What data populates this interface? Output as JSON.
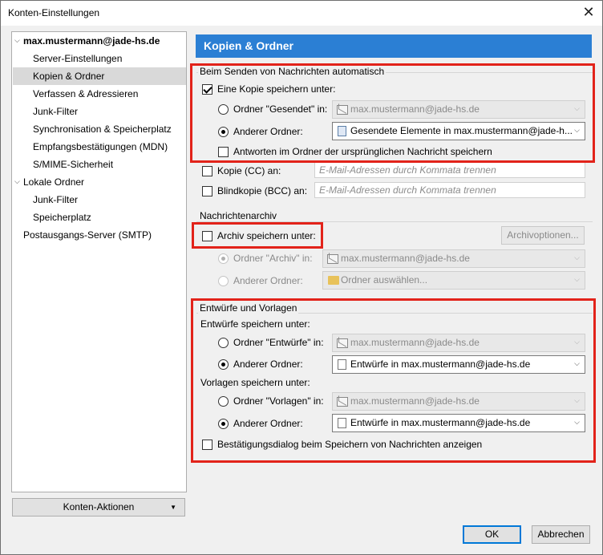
{
  "window": {
    "title": "Konten-Einstellungen",
    "close_glyph": "✕"
  },
  "tree": {
    "account": "max.mustermann@jade-hs.de",
    "account_items": [
      "Server-Einstellungen",
      "Kopien & Ordner",
      "Verfassen & Adressieren",
      "Junk-Filter",
      "Synchronisation & Speicherplatz",
      "Empfangsbestätigungen (MDN)",
      "S/MIME-Sicherheit"
    ],
    "local": "Lokale Ordner",
    "local_items": [
      "Junk-Filter",
      "Speicherplatz"
    ],
    "smtp": "Postausgangs-Server (SMTP)",
    "selected": "Kopien & Ordner"
  },
  "account_actions": "Konten-Aktionen",
  "header": "Kopien & Ordner",
  "send": {
    "group_label": "Beim Senden von Nachrichten automatisch",
    "save_copy_label": "Eine Kopie speichern unter:",
    "sent_folder_label": "Ordner \"Gesendet\" in:",
    "sent_folder_value": "max.mustermann@jade-hs.de",
    "other_folder_label": "Anderer Ordner:",
    "other_folder_value": "Gesendete Elemente in max.mustermann@jade-h...",
    "replies_label": "Antworten im Ordner der ursprünglichen Nachricht speichern",
    "cc_label": "Kopie (CC) an:",
    "cc_placeholder": "E-Mail-Adressen durch Kommata trennen",
    "bcc_label": "Blindkopie (BCC) an:",
    "bcc_placeholder": "E-Mail-Adressen durch Kommata trennen"
  },
  "archive": {
    "group_label": "Nachrichtenarchiv",
    "save_label": "Archiv speichern unter:",
    "options_button": "Archivoptionen...",
    "archive_folder_label": "Ordner \"Archiv\" in:",
    "archive_folder_value": "max.mustermann@jade-hs.de",
    "other_folder_label": "Anderer Ordner:",
    "other_folder_value": "Ordner auswählen..."
  },
  "drafts": {
    "group_label": "Entwürfe und Vorlagen",
    "drafts_label": "Entwürfe speichern unter:",
    "drafts_folder_label": "Ordner \"Entwürfe\" in:",
    "drafts_folder_value": "max.mustermann@jade-hs.de",
    "drafts_other_label": "Anderer Ordner:",
    "drafts_other_value": "Entwürfe in max.mustermann@jade-hs.de",
    "templates_label": "Vorlagen speichern unter:",
    "templates_folder_label": "Ordner \"Vorlagen\" in:",
    "templates_folder_value": "max.mustermann@jade-hs.de",
    "templates_other_label": "Anderer Ordner:",
    "templates_other_value": "Entwürfe in max.mustermann@jade-hs.de",
    "confirm_label": "Bestätigungsdialog beim Speichern von Nachrichten anzeigen"
  },
  "buttons": {
    "ok": "OK",
    "cancel": "Abbrechen"
  },
  "colors": {
    "header_bg": "#2b7fd4",
    "highlight": "#e2231a"
  }
}
